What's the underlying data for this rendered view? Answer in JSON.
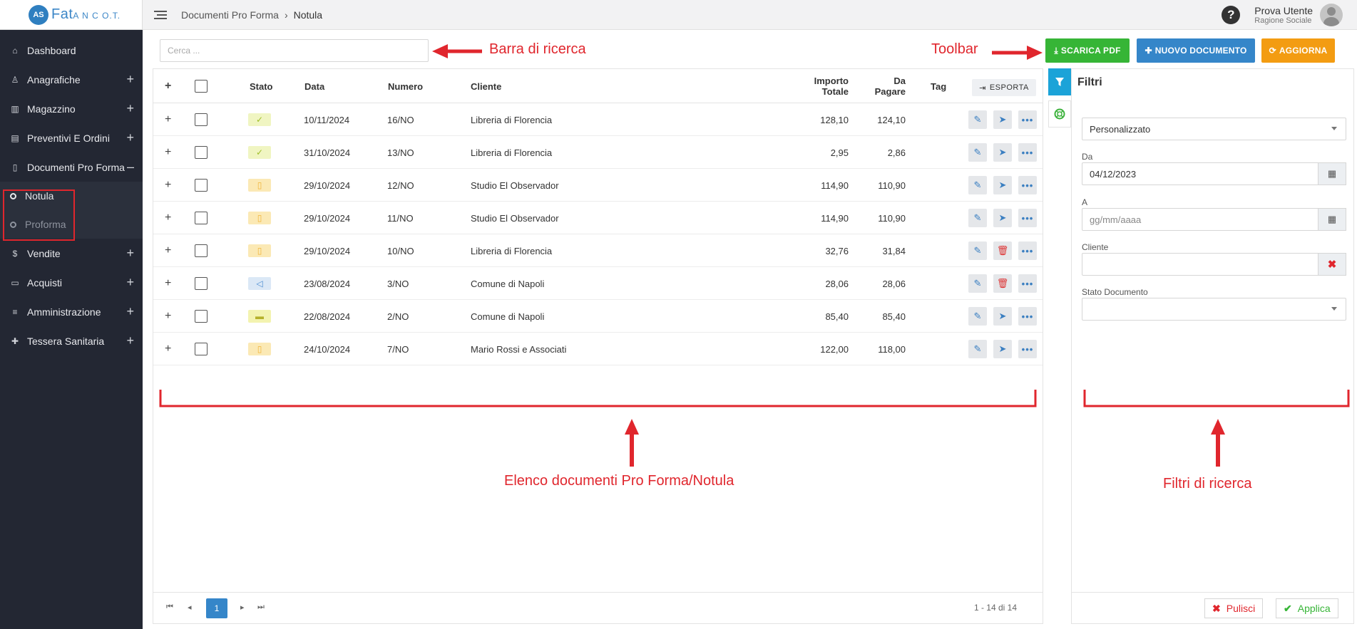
{
  "app": {
    "logo_badge": "AS",
    "logo_main": "Fat",
    "logo_sub": "A N C O.T."
  },
  "topbar": {
    "breadcrumb": [
      "Documenti Pro Forma",
      "Notula"
    ],
    "separator": "›",
    "help": "?",
    "user_name": "Prova Utente",
    "user_role": "Ragione Sociale"
  },
  "sidebar": {
    "items": [
      {
        "label": "Dashboard",
        "icon": "home-icon",
        "expand": ""
      },
      {
        "label": "Anagrafiche",
        "icon": "user-icon",
        "expand": "+"
      },
      {
        "label": "Magazzino",
        "icon": "barcode-icon",
        "expand": "+"
      },
      {
        "label": "Preventivi E Ordini",
        "icon": "clipboard-icon",
        "expand": "+"
      },
      {
        "label": "Documenti Pro Forma",
        "icon": "file-icon",
        "expand": "–"
      }
    ],
    "subitems": [
      {
        "label": "Notula",
        "active": true
      },
      {
        "label": "Proforma",
        "active": false
      }
    ],
    "items_after": [
      {
        "label": "Vendite",
        "icon": "dollar-icon",
        "expand": "+"
      },
      {
        "label": "Acquisti",
        "icon": "credit-card-icon",
        "expand": "+"
      },
      {
        "label": "Amministrazione",
        "icon": "database-icon",
        "expand": "+"
      },
      {
        "label": "Tessera Sanitaria",
        "icon": "medkit-icon",
        "expand": "+"
      }
    ]
  },
  "search": {
    "placeholder": "Cerca ..."
  },
  "toolbar": {
    "pdf_label": "SCARICA PDF",
    "new_label": "NUOVO DOCUMENTO",
    "refresh_label": "AGGIORNA"
  },
  "table": {
    "headers": {
      "plus": "+",
      "stato": "Stato",
      "data": "Data",
      "numero": "Numero",
      "cliente": "Cliente",
      "importo_1": "Importo",
      "importo_2": "Totale",
      "dapagare_1": "Da",
      "dapagare_2": "Pagare",
      "tag": "Tag",
      "export": "ESPORTA"
    },
    "rows": [
      {
        "expand": "+",
        "status": "ok",
        "status_glyph": "✓",
        "data": "10/11/2024",
        "numero": "16/NO",
        "cliente": "Libreria di Florencia",
        "importo": "128,10",
        "da_pagare": "124,10",
        "second_action": "send"
      },
      {
        "expand": "+",
        "status": "ok",
        "status_glyph": "✓",
        "data": "31/10/2024",
        "numero": "13/NO",
        "cliente": "Libreria di Florencia",
        "importo": "2,95",
        "da_pagare": "2,86",
        "second_action": "send"
      },
      {
        "expand": "+",
        "status": "doc",
        "status_glyph": "▯",
        "data": "29/10/2024",
        "numero": "12/NO",
        "cliente": "Studio El Observador",
        "importo": "114,90",
        "da_pagare": "110,90",
        "second_action": "send"
      },
      {
        "expand": "+",
        "status": "doc",
        "status_glyph": "▯",
        "data": "29/10/2024",
        "numero": "11/NO",
        "cliente": "Studio El Observador",
        "importo": "114,90",
        "da_pagare": "110,90",
        "second_action": "send"
      },
      {
        "expand": "+",
        "status": "doc",
        "status_glyph": "▯",
        "data": "29/10/2024",
        "numero": "10/NO",
        "cliente": "Libreria di Florencia",
        "importo": "32,76",
        "da_pagare": "31,84",
        "second_action": "delete"
      },
      {
        "expand": "+",
        "status": "send",
        "status_glyph": "◁",
        "data": "23/08/2024",
        "numero": "3/NO",
        "cliente": "Comune di Napoli",
        "importo": "28,06",
        "da_pagare": "28,06",
        "second_action": "delete"
      },
      {
        "expand": "+",
        "status": "truck",
        "status_glyph": "▬",
        "data": "22/08/2024",
        "numero": "2/NO",
        "cliente": "Comune di Napoli",
        "importo": "85,40",
        "da_pagare": "85,40",
        "second_action": "send"
      },
      {
        "expand": "+",
        "status": "doc",
        "status_glyph": "▯",
        "data": "24/10/2024",
        "numero": "7/NO",
        "cliente": "Mario Rossi e Associati",
        "importo": "122,00",
        "da_pagare": "118,00",
        "second_action": "send"
      }
    ]
  },
  "pagination": {
    "first": "⏮",
    "prev": "◂",
    "current": "1",
    "next": "▸",
    "last": "⏭",
    "info": "1 - 14 di 14"
  },
  "filters": {
    "title": "Filtri",
    "period": "Personalizzato",
    "da_label": "Da",
    "da_value": "04/12/2023",
    "a_label": "A",
    "a_placeholder": "gg/mm/aaaa",
    "cliente_label": "Cliente",
    "cliente_value": "",
    "stato_label": "Stato Documento",
    "stato_value": "",
    "clear_label": "Pulisci",
    "apply_label": "Applica"
  },
  "annotations": {
    "search": "Barra di ricerca",
    "toolbar": "Toolbar",
    "list": "Elenco documenti Pro Forma/Notula",
    "filters": "Filtri di ricerca",
    "color": "#e0262d"
  }
}
